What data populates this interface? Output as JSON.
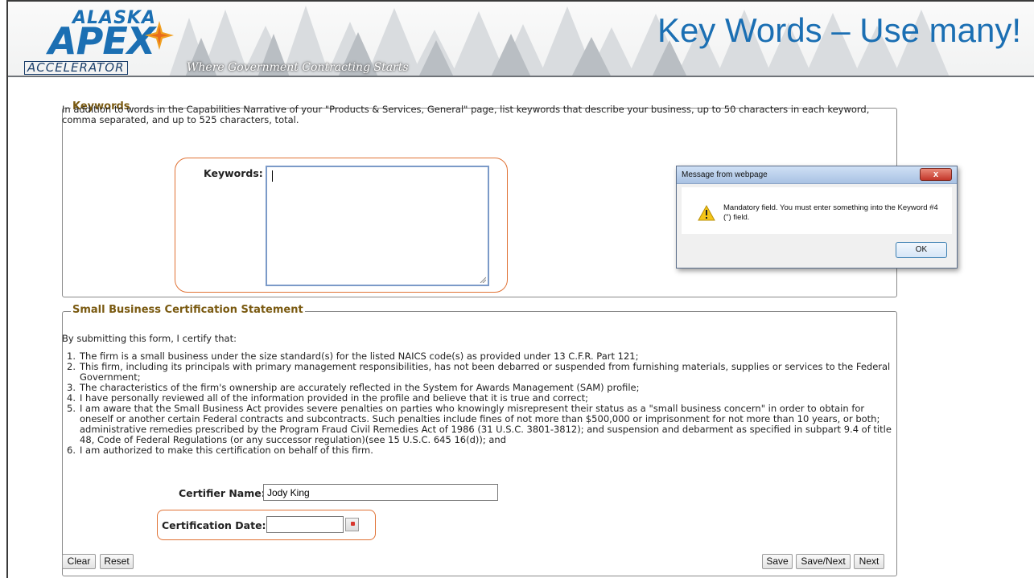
{
  "slide": {
    "title": "Key Words – Use many!",
    "logo": {
      "top": "ALASKA",
      "main": "APEX",
      "bottom": "ACCELERATOR"
    },
    "tagline": "Where Government Contracting Starts"
  },
  "keywords_section": {
    "legend": "Keywords",
    "description": "In addition to words in the Capabilities Narrative of your \"Products & Services, General\" page, list keywords that describe your business, up to 50 characters in each keyword, comma separated, and up to 525 characters, total.",
    "field_label": "Keywords:",
    "field_value": ""
  },
  "certification_section": {
    "legend": "Small Business Certification Statement",
    "intro": "By submitting this form, I certify that:",
    "items": [
      {
        "num": "1.",
        "text": "The firm is a small business under the size standard(s) for the listed NAICS code(s) as provided under 13 C.F.R. Part 121;"
      },
      {
        "num": "2.",
        "text": "This firm, including its principals with primary management responsibilities, has not been debarred or suspended from furnishing materials, supplies or services to the Federal Government;"
      },
      {
        "num": "3.",
        "text": "The characteristics of the firm's ownership are accurately reflected in the System for Awards Management (SAM) profile;"
      },
      {
        "num": "4.",
        "text": "I have personally reviewed all of the information provided in the profile and believe that it is true and correct;"
      },
      {
        "num": "5.",
        "text": "I am aware that the Small Business Act provides severe penalties on parties who knowingly misrepresent their status as a \"small business concern\" in order to obtain for oneself or another certain Federal contracts and subcontracts. Such penalties include fines of not more than $500,000 or imprisonment for not more than 10 years, or both; administrative remedies prescribed by the Program Fraud Civil Remedies Act of 1986 (31 U.S.C. 3801-3812); and suspension and debarment as specified in subpart 9.4 of title 48, Code of Federal Regulations (or any successor regulation)(see 15 U.S.C. 645 16(d)); and"
      },
      {
        "num": "6.",
        "text": "I am authorized to make this certification on behalf of this firm."
      }
    ],
    "certifier_label": "Certifier Name:",
    "certifier_value": "Jody King",
    "date_label": "Certification Date:",
    "date_value": ""
  },
  "buttons": {
    "clear": "Clear",
    "reset": "Reset",
    "save": "Save",
    "save_next": "Save/Next",
    "next": "Next"
  },
  "dialog": {
    "title": "Message from webpage",
    "close": "x",
    "message": "Mandatory field. You must enter something into the Keyword #4 (\") field.",
    "ok": "OK",
    "icon": "warning-icon"
  },
  "colors": {
    "brand_blue": "#1b6fb3",
    "legend_brown": "#7a5a11",
    "highlight_orange": "#e07235"
  }
}
